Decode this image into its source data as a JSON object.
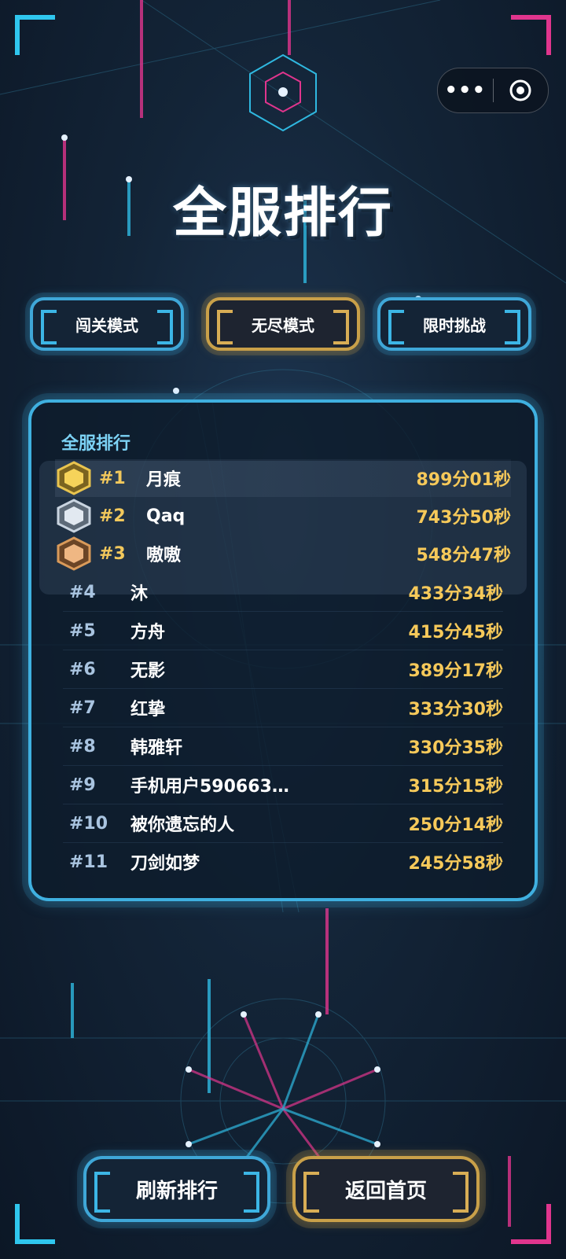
{
  "header": {
    "title": "全服排行",
    "capsule": {
      "more_icon": "more-dots-icon",
      "close_icon": "target-circle-icon"
    }
  },
  "modes": [
    {
      "label": "闯关模式",
      "active": false
    },
    {
      "label": "无尽模式",
      "active": true
    },
    {
      "label": "限时挑战",
      "active": false
    }
  ],
  "leaderboard": {
    "title": "全服排行",
    "top": [
      {
        "rank": "#1",
        "name": "月痕",
        "score": "899分01秒",
        "medal": "gold-medal-icon"
      },
      {
        "rank": "#2",
        "name": "Qaq",
        "score": "743分50秒",
        "medal": "silver-medal-icon"
      },
      {
        "rank": "#3",
        "name": "嗷嗷",
        "score": "548分47秒",
        "medal": "bronze-medal-icon"
      }
    ],
    "rows": [
      {
        "rank": "#4",
        "name": "沐",
        "score": "433分34秒"
      },
      {
        "rank": "#5",
        "name": "方舟",
        "score": "415分45秒"
      },
      {
        "rank": "#6",
        "name": "无影",
        "score": "389分17秒"
      },
      {
        "rank": "#7",
        "name": "红挚",
        "score": "333分30秒"
      },
      {
        "rank": "#8",
        "name": "韩雅轩",
        "score": "330分35秒"
      },
      {
        "rank": "#9",
        "name": "手机用户590663…",
        "score": "315分15秒"
      },
      {
        "rank": "#10",
        "name": "被你遗忘的人",
        "score": "250分14秒"
      },
      {
        "rank": "#11",
        "name": "刀剑如梦",
        "score": "245分58秒"
      }
    ]
  },
  "footer": {
    "refresh_label": "刷新排行",
    "home_label": "返回首页"
  },
  "colors": {
    "accent_cyan": "#3fa7d8",
    "accent_gold": "#c9a049",
    "score_gold": "#f6c95a",
    "panel_title": "#7cd2f5"
  }
}
